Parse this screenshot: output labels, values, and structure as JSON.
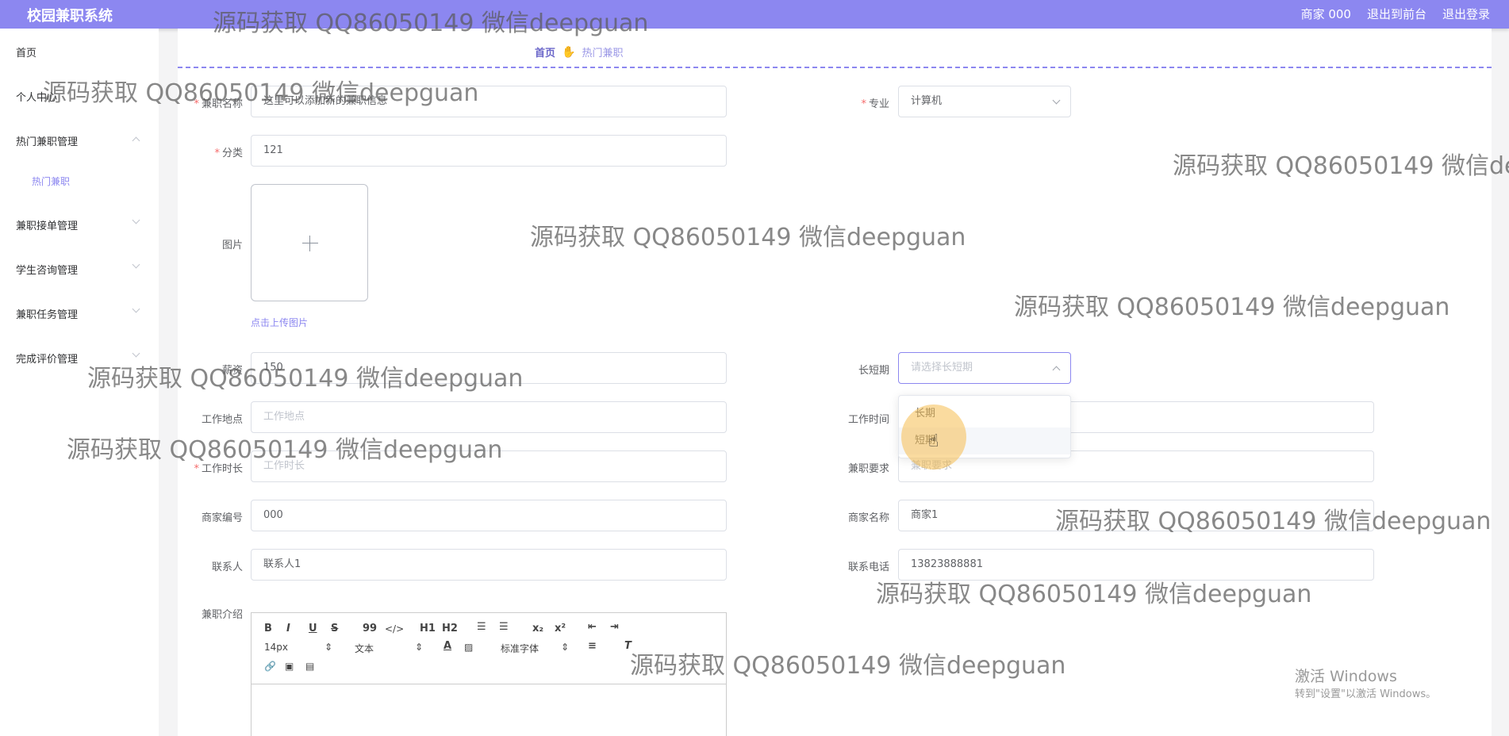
{
  "header": {
    "brand": "校园兼职系统",
    "user": "商家 000",
    "to_front": "退出到前台",
    "logout": "退出登录"
  },
  "sidebar": {
    "items": [
      {
        "label": "首页"
      },
      {
        "label": "个人中心"
      },
      {
        "label": "热门兼职管理",
        "expanded": true
      },
      {
        "label": "热门兼职",
        "sub": true,
        "active": true
      },
      {
        "label": "兼职接单管理"
      },
      {
        "label": "学生咨询管理"
      },
      {
        "label": "兼职任务管理"
      },
      {
        "label": "完成评价管理"
      }
    ]
  },
  "breadcrumb": {
    "home": "首页",
    "separator_icon": "hand-icon",
    "current": "热门兼职"
  },
  "form": {
    "name": {
      "label": "兼职名称",
      "value": "这里可以添加新的兼职信息"
    },
    "major": {
      "label": "专业",
      "value": "计算机"
    },
    "category": {
      "label": "分类",
      "value": "121"
    },
    "image": {
      "label": "图片",
      "hint": "点击上传图片"
    },
    "salary": {
      "label": "薪资",
      "value": "150"
    },
    "term": {
      "label": "长短期",
      "placeholder": "请选择长短期",
      "options": [
        "长期",
        "短期"
      ],
      "hovered": "短期"
    },
    "location": {
      "label": "工作地点",
      "placeholder": "工作地点"
    },
    "work_time": {
      "label": "工作时间"
    },
    "duration": {
      "label": "工作时长",
      "placeholder": "工作时长"
    },
    "requirement": {
      "label": "兼职要求",
      "placeholder": "兼职要求"
    },
    "merchant_no": {
      "label": "商家编号",
      "value": "000"
    },
    "merchant_name": {
      "label": "商家名称",
      "value": "商家1"
    },
    "contact": {
      "label": "联系人",
      "value": "联系人1"
    },
    "phone": {
      "label": "联系电话",
      "value": "13823888881"
    },
    "intro": {
      "label": "兼职介绍"
    }
  },
  "editor_toolbar": {
    "bold": "B",
    "italic": "I",
    "underline": "U",
    "strike": "S",
    "quote": "99",
    "code": "</>",
    "h1": "H1",
    "h2": "H2",
    "sub": "x₂",
    "sup": "x²",
    "font_size": "14px",
    "header_select": "文本",
    "font_family": "标准字体"
  },
  "watermark": "源码获取 QQ86050149 微信deepguan",
  "windows_activation": {
    "title": "激活 Windows",
    "subtitle": "转到\"设置\"以激活 Windows。"
  },
  "colors": {
    "accent": "#8c87f0",
    "required": "#f56c6c"
  }
}
